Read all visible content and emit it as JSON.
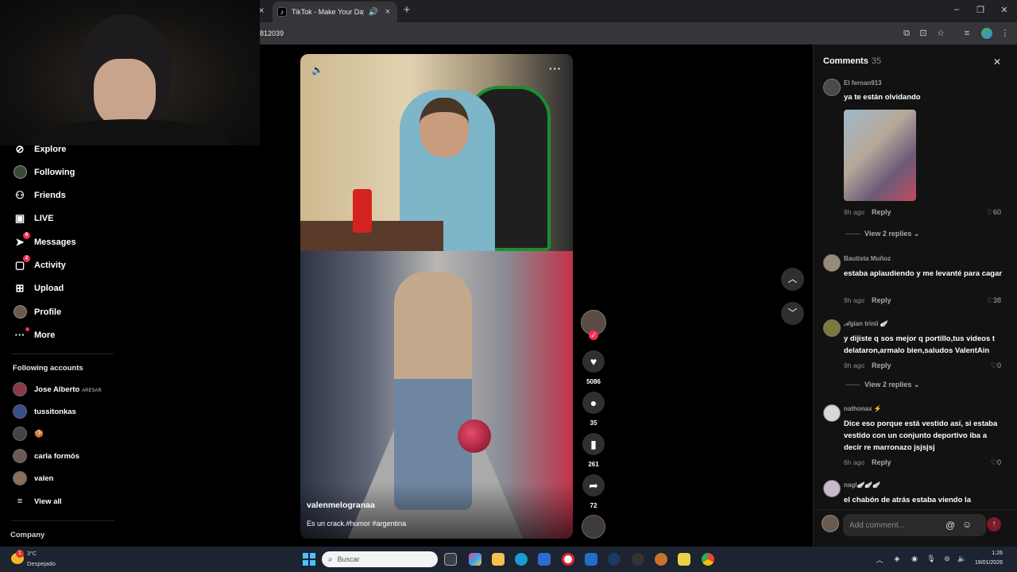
{
  "browser": {
    "tab_title": "TikTok - Make Your Day",
    "url": "812039",
    "new_tab": "+",
    "tab_close": "×",
    "minimize": "–",
    "restore": "❐",
    "close": "✕"
  },
  "sidebar": {
    "nav": [
      {
        "label": "Explore",
        "icon": "compass-icon",
        "glyph": "⊘"
      },
      {
        "label": "Following",
        "icon": "following-avatar-icon",
        "glyph": ""
      },
      {
        "label": "Friends",
        "icon": "friends-icon",
        "glyph": "👥"
      },
      {
        "label": "LIVE",
        "icon": "live-icon",
        "glyph": "▣"
      },
      {
        "label": "Messages",
        "icon": "send-icon",
        "glyph": "➤",
        "badge": "6"
      },
      {
        "label": "Activity",
        "icon": "activity-icon",
        "glyph": "▢",
        "badge": "2"
      },
      {
        "label": "Upload",
        "icon": "upload-icon",
        "glyph": "⊞"
      },
      {
        "label": "Profile",
        "icon": "profile-avatar-icon",
        "glyph": ""
      },
      {
        "label": "More",
        "icon": "more-icon",
        "glyph": "···"
      }
    ],
    "following_title": "Following accounts",
    "accounts": [
      {
        "name": "Jose Alberto",
        "sub": "ARESAR",
        "color": "#8a3a46"
      },
      {
        "name": "tussitonkas",
        "sub": "",
        "color": "#3a4e8a"
      },
      {
        "name": "🍪",
        "sub": "",
        "color": "#444444"
      },
      {
        "name": "carla formós",
        "sub": "",
        "color": "#6b5a52"
      },
      {
        "name": "valen",
        "sub": "",
        "color": "#8a6e56"
      }
    ],
    "view_all": "View all",
    "company": "Company"
  },
  "video": {
    "author": "valenmelogranaa",
    "caption": "Es un crack.#humor #argentina",
    "mute_glyph": "🔈",
    "more_glyph": "···"
  },
  "actions": {
    "likes": "5086",
    "comments": "35",
    "saves": "261",
    "shares": "72"
  },
  "comments": {
    "title": "Comments",
    "count": "35",
    "items": [
      {
        "user": "El fernan913",
        "text": "ya te están olvidando",
        "time": "9h ago",
        "reply": "Reply",
        "likes": "60",
        "view_replies": "View 2 replies"
      },
      {
        "user": "Bautista Muñoz",
        "text": "estaba aplaudiendo y me levanté para cagar",
        "time": "9h ago",
        "reply": "Reply",
        "likes": "38"
      },
      {
        "user": "𝒜gian trinii 🪽",
        "text": "y dijiste q sos mejor q portillo,tus videos t delataron,armalo bien,saludos ValentAin",
        "time": "9h ago",
        "reply": "Reply",
        "likes": "0",
        "view_replies": "View 2 replies"
      },
      {
        "user": "nathonax ⚡",
        "text": "Dice eso porque está vestido así, si estaba vestido con un conjunto deportivo iba a decir re marronazo jsjsjsj",
        "time": "6h ago",
        "reply": "Reply",
        "likes": "0"
      },
      {
        "user": "nagl🪽🪽🪽",
        "text": "el chabón de atrás estaba viendo la"
      }
    ],
    "input_placeholder": "Add comment..."
  },
  "taskbar": {
    "weather_temp": "3°C",
    "weather_desc": "Despejado",
    "weather_badge": "1",
    "search_placeholder": "Buscar",
    "time": "1:26",
    "date": "19/01/2026"
  }
}
